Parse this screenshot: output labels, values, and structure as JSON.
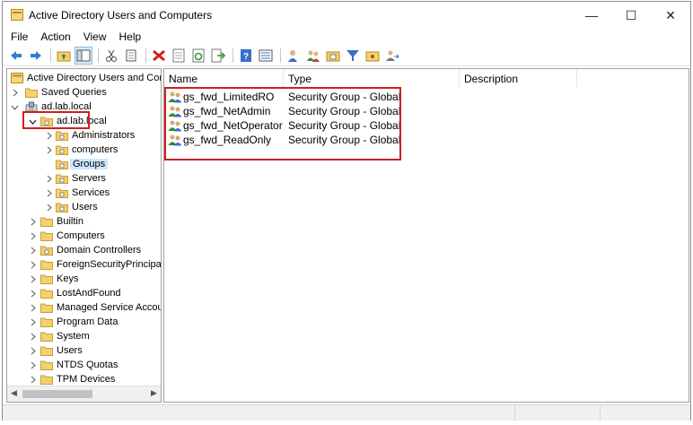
{
  "window": {
    "title": "Active Directory Users and Computers",
    "minimize_glyph": "—",
    "maximize_glyph": "☐",
    "close_glyph": "✕"
  },
  "menu": [
    "File",
    "Action",
    "View",
    "Help"
  ],
  "toolbar_icons": [
    "back-icon",
    "forward-icon",
    "up-folder-icon",
    "show-hide-tree-icon",
    "cut-icon",
    "copy-icon",
    "delete-icon",
    "properties-icon",
    "refresh-icon",
    "export-list-icon",
    "help-icon",
    "details-view-icon",
    "new-user-icon",
    "new-group-icon",
    "new-ou-icon",
    "filter-icon",
    "add-to-group-icon",
    "delegate-icon"
  ],
  "tree": {
    "root": "Active Directory Users and Computers",
    "saved_queries": "Saved Queries",
    "domain": "ad.lab.local",
    "domain_sub": "ad.lab.local",
    "ous": [
      "Administrators",
      "computers",
      "Groups",
      "Servers",
      "Services",
      "Users"
    ],
    "selected": "Groups",
    "containers": [
      "Builtin",
      "Computers",
      "Domain Controllers",
      "ForeignSecurityPrincipals",
      "Keys",
      "LostAndFound",
      "Managed Service Accounts",
      "Program Data",
      "System",
      "Users",
      "NTDS Quotas",
      "TPM Devices"
    ]
  },
  "list": {
    "columns": [
      "Name",
      "Type",
      "Description"
    ],
    "rows": [
      {
        "name": "gs_fwd_LimitedRO",
        "type": "Security Group - Global",
        "description": ""
      },
      {
        "name": "gs_fwd_NetAdmin",
        "type": "Security Group - Global",
        "description": ""
      },
      {
        "name": "gs_fwd_NetOperator",
        "type": "Security Group - Global",
        "description": ""
      },
      {
        "name": "gs_fwd_ReadOnly",
        "type": "Security Group - Global",
        "description": ""
      }
    ]
  },
  "colors": {
    "highlight_border": "#cc1f1f",
    "selection_bg": "#cce8ff",
    "folder_yellow": "#f3d26b"
  }
}
